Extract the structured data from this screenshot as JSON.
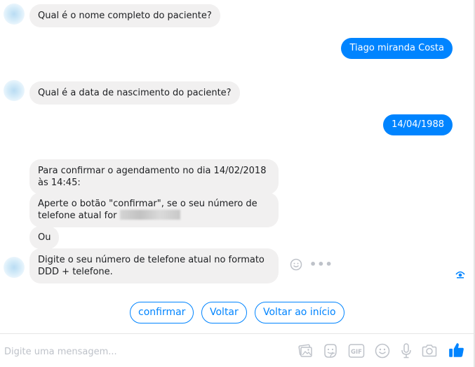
{
  "messages": [
    {
      "from": "bot",
      "text": "Qual é o nome completo do paciente?"
    },
    {
      "from": "user",
      "text": "Tiago miranda Costa"
    },
    {
      "from": "bot",
      "text": "Qual é a data de nascimento do paciente?"
    },
    {
      "from": "user",
      "text": "14/04/1988"
    },
    {
      "from": "bot",
      "text": "Para confirmar o agendamento no dia 14/02/2018 às 14:45:"
    },
    {
      "from": "bot",
      "text": "Aperte o botão \"confirmar\", se o seu número de telefone atual for"
    },
    {
      "from": "bot",
      "text": "Ou"
    },
    {
      "from": "bot",
      "text": "Digite o seu número de telefone atual no formato DDD + telefone."
    }
  ],
  "quick_replies": [
    "confirmar",
    "Voltar",
    "Voltar ao início"
  ],
  "composer": {
    "placeholder": "Digite uma mensagem..."
  },
  "icons": [
    "image-icon",
    "sticker-icon",
    "gif-icon",
    "emoji-icon",
    "microphone-icon",
    "camera-icon",
    "thumbs-up-icon"
  ],
  "colors": {
    "accent": "#0084ff",
    "bot_bubble": "#f1f0f0",
    "icon_gray": "#bec2c9"
  }
}
